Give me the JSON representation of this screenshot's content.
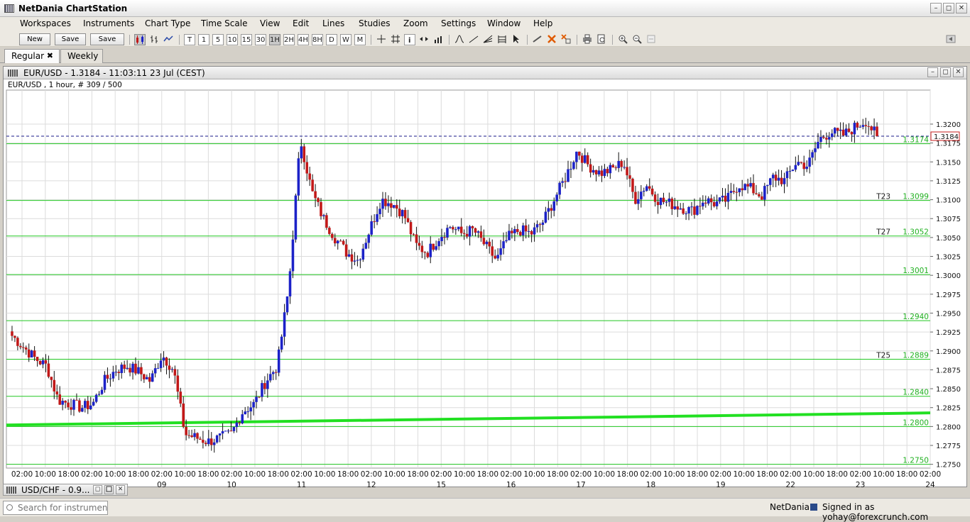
{
  "app": {
    "title": "NetDania ChartStation",
    "menu": [
      "Workspaces",
      "Instruments",
      "Chart Type",
      "Time Scale",
      "View",
      "Edit",
      "Lines",
      "Studies",
      "Zoom",
      "Settings",
      "Window",
      "Help"
    ],
    "window_controls": [
      "–",
      "◻",
      "✕"
    ]
  },
  "toolbar": {
    "buttons": [
      "New",
      "Save",
      "Save as..."
    ],
    "timescales": [
      "T",
      "1",
      "5",
      "10",
      "15",
      "30",
      "1H",
      "2H",
      "4H",
      "8H",
      "D",
      "W",
      "M"
    ],
    "active_timescale": "1H",
    "tool_icons": [
      "candlestick-icon",
      "ohlc-bar-icon",
      "line-chart-icon",
      "crosshair-icon",
      "grid-icon",
      "info-icon",
      "scroll-icon",
      "volume-icon",
      "bell-curve-icon",
      "trend-line-icon",
      "fan-line-icon",
      "fibonacci-icon",
      "cursor-icon",
      "draw-line-icon",
      "delete-icon",
      "delete-all-icon",
      "print-icon",
      "print-preview-icon",
      "zoom-in-icon",
      "zoom-out-icon",
      "zoom-reset-icon",
      "panel-toggle-icon"
    ]
  },
  "tabs": [
    {
      "label": "Regular",
      "close": "✖",
      "active": true
    },
    {
      "label": "Weekly",
      "active": false
    }
  ],
  "chart_window": {
    "title": "EUR/USD - 1.3184 - 11:03:11  23 Jul (CEST)",
    "subtitle": "EUR/USD , 1 hour, # 309 / 500"
  },
  "minimized_window": {
    "title": "USD/CHF - 0.9..."
  },
  "statusbar": {
    "search_placeholder": "Search for instrument",
    "brand": "NetDania",
    "user": "Signed in as yohay@forexcrunch.com"
  },
  "colors": {
    "up": "#1c22c8",
    "down": "#c21818",
    "level_line": "#22c822",
    "ma_line": "#22e022",
    "last_price_line": "#1a1a8a",
    "price_label": "#c81e1e"
  },
  "chart_data": {
    "type": "candlestick",
    "instrument": "EUR/USD",
    "interval": "1 hour",
    "ylim": [
      1.2745,
      1.3245
    ],
    "yticks": [
      "1.2750",
      "1.2775",
      "1.2800",
      "1.2825",
      "1.2850",
      "1.2875",
      "1.2900",
      "1.2925",
      "1.2950",
      "1.2975",
      "1.3000",
      "1.3025",
      "1.3050",
      "1.3075",
      "1.3100",
      "1.3125",
      "1.3150",
      "1.3175",
      "1.3200"
    ],
    "xtick_labels": [
      "02:00",
      "10:00",
      "18:00",
      "02:00",
      "10:00",
      "18:00",
      "02:00",
      "10:00",
      "18:00",
      "02:00",
      "10:00",
      "18:00",
      "02:00",
      "10:00",
      "18:00",
      "02:00",
      "10:00",
      "18:00",
      "02:00",
      "10:00",
      "18:00",
      "02:00",
      "10:00",
      "18:00",
      "02:00",
      "10:00",
      "18:00",
      "02:00",
      "10:00",
      "18:00",
      "02:00",
      "10:00",
      "18:00",
      "02:00",
      "10:00",
      "18:00",
      "02:00",
      "10:00",
      "18:00",
      "02:00"
    ],
    "date_labels": [
      "09",
      "10",
      "11",
      "12",
      "15",
      "16",
      "17",
      "18",
      "19",
      "22",
      "23",
      "24"
    ],
    "last_price": "1.3184",
    "levels": [
      {
        "value": 1.3174,
        "label": "1.3174",
        "name": ""
      },
      {
        "value": 1.3099,
        "label": "1.3099",
        "name": "T23"
      },
      {
        "value": 1.3052,
        "label": "1.3052",
        "name": "T27"
      },
      {
        "value": 1.3001,
        "label": "1.3001",
        "name": ""
      },
      {
        "value": 1.294,
        "label": "1.2940",
        "name": ""
      },
      {
        "value": 1.2889,
        "label": "1.2889",
        "name": "T25"
      },
      {
        "value": 1.284,
        "label": "1.2840",
        "name": ""
      },
      {
        "value": 1.28,
        "label": "1.2800",
        "name": ""
      },
      {
        "value": 1.275,
        "label": "1.2750",
        "name": ""
      }
    ],
    "moving_average": {
      "start": 1.2802,
      "end": 1.2818
    },
    "anchors": [
      1.292,
      1.2905,
      1.289,
      1.288,
      1.2835,
      1.283,
      1.2825,
      1.283,
      1.286,
      1.2875,
      1.288,
      1.2872,
      1.286,
      1.2895,
      1.2875,
      1.279,
      1.2785,
      1.278,
      1.2785,
      1.279,
      1.282,
      1.283,
      1.286,
      1.288,
      1.2985,
      1.318,
      1.311,
      1.3075,
      1.305,
      1.303,
      1.302,
      1.306,
      1.31,
      1.3095,
      1.308,
      1.304,
      1.303,
      1.305,
      1.3065,
      1.3055,
      1.306,
      1.304,
      1.302,
      1.305,
      1.306,
      1.3055,
      1.307,
      1.31,
      1.313,
      1.3165,
      1.3145,
      1.3135,
      1.314,
      1.315,
      1.31,
      1.312,
      1.31,
      1.3095,
      1.309,
      1.3085,
      1.31,
      1.3095,
      1.31,
      1.312,
      1.3115,
      1.3105,
      1.313,
      1.3125,
      1.315,
      1.3145,
      1.318,
      1.319,
      1.3185,
      1.3195,
      1.3205,
      1.3184
    ]
  }
}
